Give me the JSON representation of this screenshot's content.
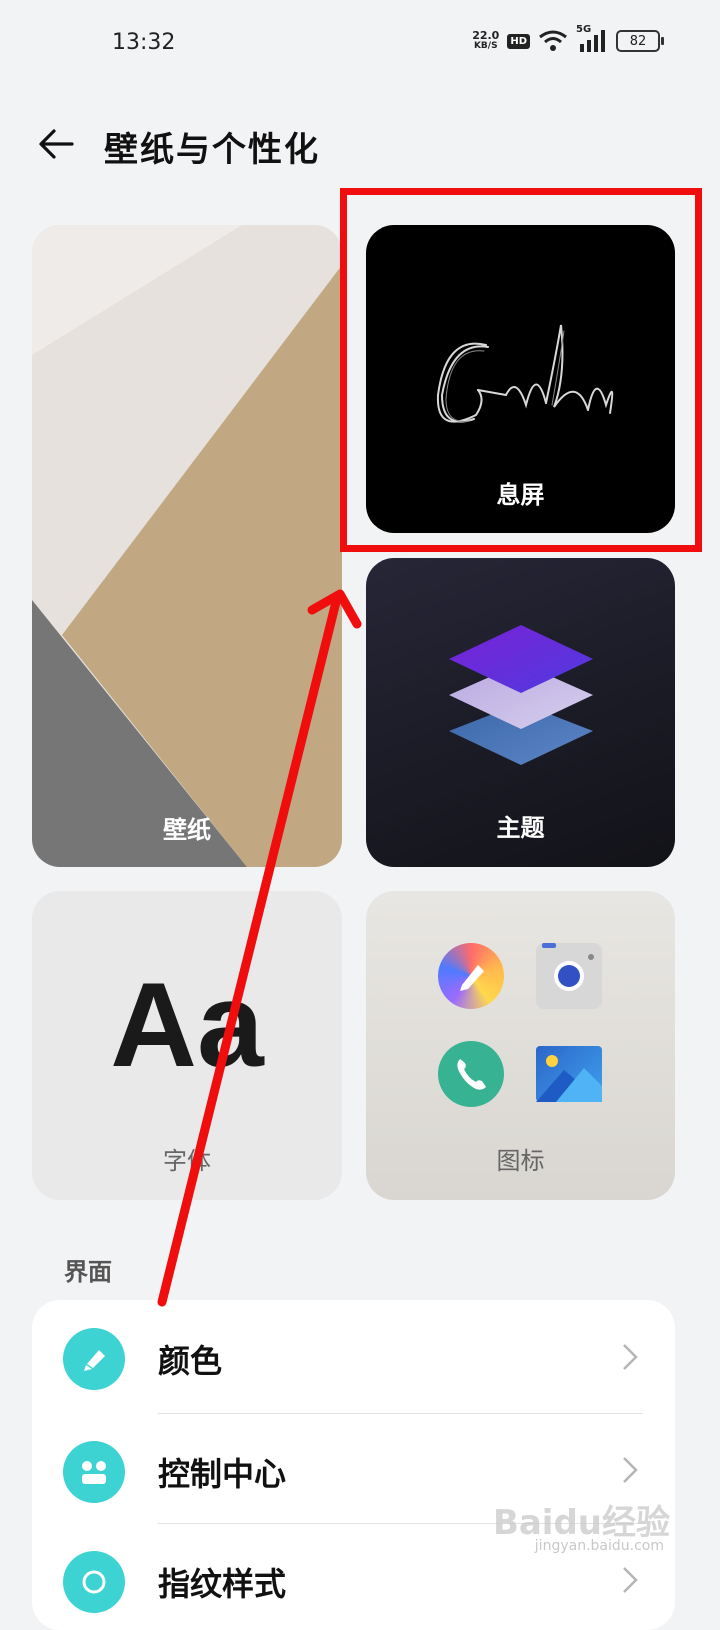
{
  "status_bar": {
    "time": "13:32",
    "net_speed_value": "22.0",
    "net_speed_unit": "KB/S",
    "hd": "HD",
    "network": "5G",
    "battery": "82"
  },
  "header": {
    "title": "壁纸与个性化"
  },
  "cards": {
    "wallpaper": "壁纸",
    "aod": "息屏",
    "theme": "主题",
    "font": "字体",
    "font_sample": "Aa",
    "icons": "图标"
  },
  "section": {
    "title": "界面"
  },
  "list": {
    "items": [
      {
        "label": "颜色"
      },
      {
        "label": "控制中心"
      },
      {
        "label": "指纹样式"
      }
    ]
  },
  "watermark": {
    "main": "Baidu经验",
    "sub": "jingyan.baidu.com"
  },
  "colors": {
    "accent_teal": "#3ed3d3",
    "annotation_red": "#f00d0d"
  }
}
